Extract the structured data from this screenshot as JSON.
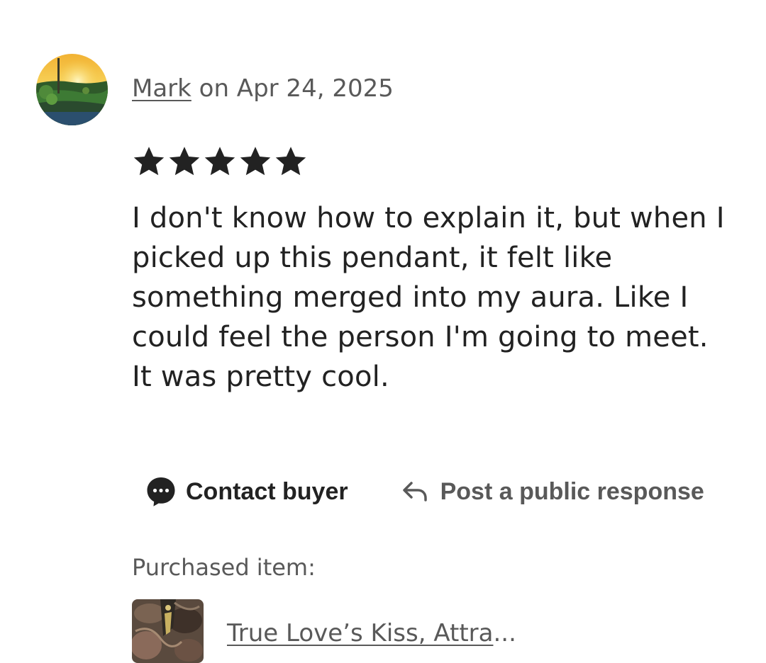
{
  "review": {
    "reviewer_name": "Mark",
    "date_text": " on Apr 24, 2025",
    "rating": 5,
    "rating_max": 5,
    "text": "I don't know how to explain it, but when I picked up this pendant, it felt like something merged into my aura. Like I could feel the person I'm going to meet. It was pretty cool."
  },
  "actions": {
    "contact_label": "Contact buyer",
    "contact_icon": "chat-bubble-icon",
    "respond_label": "Post a public response",
    "respond_icon": "reply-arrow-icon"
  },
  "purchased": {
    "label": "Purchased item:",
    "item_title": "True Love’s Kiss, Attra",
    "ellipsis": "..."
  },
  "colors": {
    "primary_text": "#222222",
    "secondary_text": "#595959",
    "star": "#222222",
    "background": "#ffffff"
  }
}
